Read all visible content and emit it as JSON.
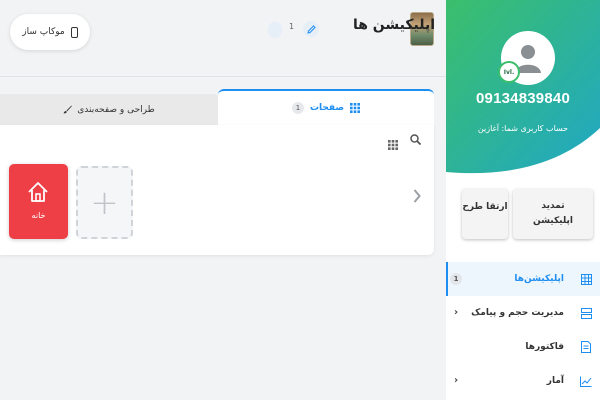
{
  "header": {
    "title": "اپلیکیشن ها",
    "title_count": "1",
    "mockup_label": "موکاپ ساز"
  },
  "sidebar": {
    "phone": "09134839840",
    "account_type": "حساب کاربری شما: آغازین",
    "level_badge": "Ivl.",
    "renew_label_1": "تمدید",
    "renew_label_2": "اپلیکیشن",
    "upgrade_label": "ارتقا طرح",
    "menu": [
      {
        "label": "اپلیکیشن‌ها",
        "count": "1"
      },
      {
        "label": "مدیریت حجم و پیامک",
        "chevron": "‹"
      },
      {
        "label": "فاکتورها"
      },
      {
        "label": "آمار",
        "chevron": "‹"
      }
    ]
  },
  "tabs": {
    "pages_label": "صفحات",
    "pages_count": "1",
    "design_label": "طراحی و صفحه‌بندی"
  },
  "panel": {
    "add_symbol": "+",
    "home_label": "خانه",
    "arrow": "›"
  },
  "colors": {
    "accent": "#1f8ef1",
    "gradient_start": "#3bbf6b",
    "gradient_end": "#20a7c5",
    "home_tile": "#ee3f47"
  }
}
